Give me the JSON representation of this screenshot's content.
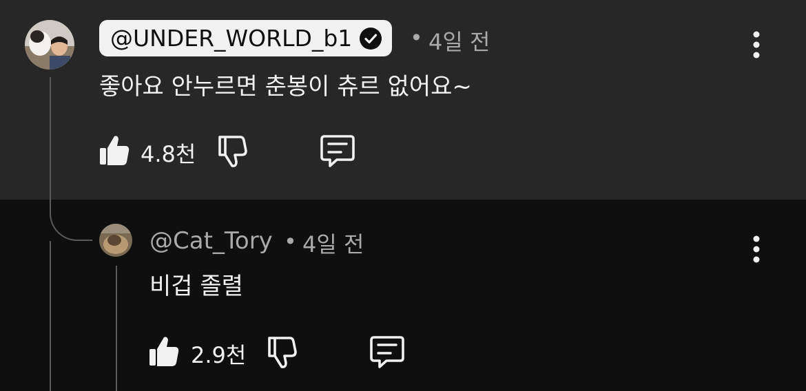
{
  "comment": {
    "handle": "@UNDER_WORLD_b1",
    "verified": true,
    "separator": "•",
    "time": "4일 전",
    "text": "좋아요 안누르면 춘봉이 츄르 없어요~",
    "like_count": "4.8천",
    "icons": {
      "like": "thumbs-up-icon",
      "dislike": "thumbs-down-icon",
      "reply": "reply-comment-icon",
      "more": "more-vertical-icon",
      "verified": "verified-check-icon"
    }
  },
  "reply": {
    "handle": "@Cat_Tory",
    "separator": "•",
    "time": "4일 전",
    "text": "비겁 졸렬",
    "like_count": "2.9천"
  },
  "colors": {
    "highlight_bg": "#272727",
    "page_bg": "#0f0f0f",
    "text_primary": "#f1f1f1",
    "text_secondary": "#aaaaaa",
    "pill_bg": "#f1f1f1"
  }
}
